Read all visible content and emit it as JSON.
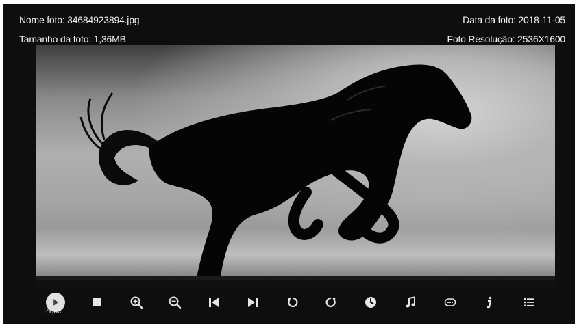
{
  "photo_info": {
    "name": "Nome foto: 34684923894.jpg",
    "size": "Tamanho da foto: 1,36MB",
    "date": "Data da foto: 2018-11-05",
    "resolution": "Foto Resolução: 2536X1600"
  },
  "toolbar": {
    "buttons": [
      {
        "icon": "play-icon",
        "label": "Toque",
        "selected": true
      },
      {
        "icon": "stop-icon"
      },
      {
        "icon": "zoom-in-icon"
      },
      {
        "icon": "zoom-out-icon"
      },
      {
        "icon": "skip-previous-icon"
      },
      {
        "icon": "skip-next-icon"
      },
      {
        "icon": "rotate-left-icon"
      },
      {
        "icon": "rotate-right-icon"
      },
      {
        "icon": "clock-icon"
      },
      {
        "icon": "music-icon"
      },
      {
        "icon": "subtitle-icon"
      },
      {
        "icon": "info-icon"
      },
      {
        "icon": "list-icon"
      }
    ]
  },
  "colors": {
    "background": "#0e0e0e",
    "text": "#f2f2f2",
    "icon": "#e6e6e6"
  }
}
